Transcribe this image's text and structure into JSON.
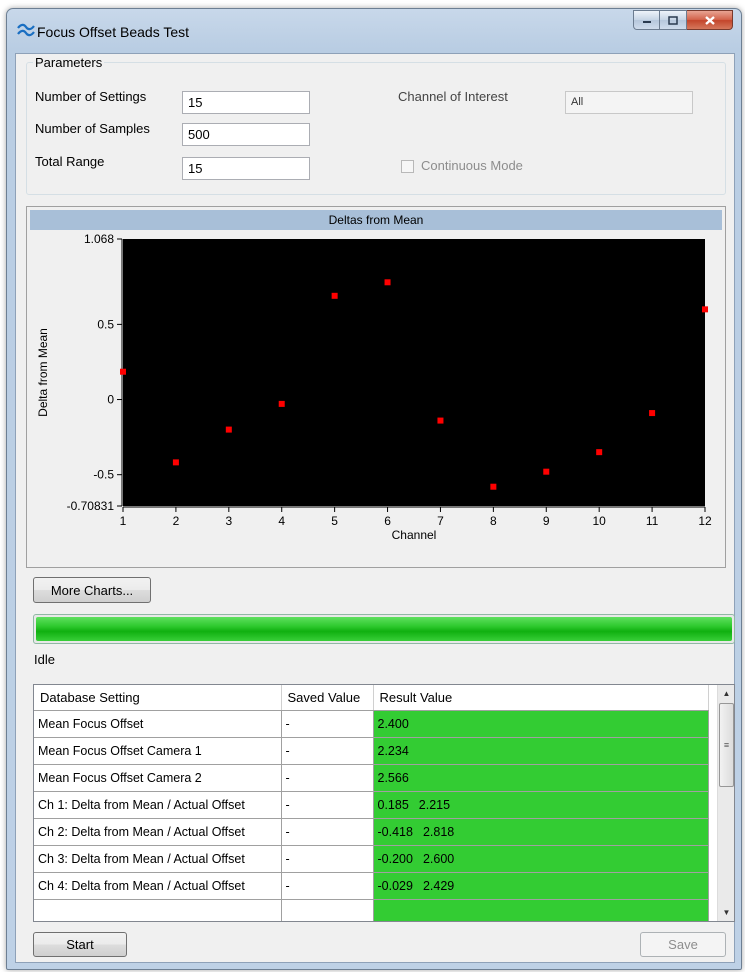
{
  "window": {
    "title": "Focus Offset Beads Test",
    "app_icon": "wave-icon",
    "controls": [
      "minimize-icon",
      "maximize-icon",
      "close-icon"
    ]
  },
  "parameters": {
    "group_label": "Parameters",
    "number_of_settings_label": "Number of Settings",
    "number_of_settings_value": "15",
    "number_of_samples_label": "Number of Samples",
    "number_of_samples_value": "500",
    "total_range_label": "Total Range",
    "total_range_value": "15",
    "channel_of_interest_label": "Channel of Interest",
    "channel_of_interest_value": "All",
    "continuous_mode_label": "Continuous Mode",
    "continuous_mode_checked": false
  },
  "chart_data": {
    "type": "scatter",
    "title": "Deltas from Mean",
    "xlabel": "Channel",
    "ylabel": "Delta from Mean",
    "xlim": [
      1,
      12
    ],
    "ylim": [
      -0.70831,
      1.068
    ],
    "xticks": [
      "1",
      "2",
      "3",
      "4",
      "5",
      "6",
      "7",
      "8",
      "9",
      "10",
      "11",
      "12"
    ],
    "yticks": [
      {
        "value": 1.068,
        "label": "1.068"
      },
      {
        "value": 0.5,
        "label": "0.5"
      },
      {
        "value": 0,
        "label": "0"
      },
      {
        "value": -0.5,
        "label": "-0.5"
      },
      {
        "value": -0.70831,
        "label": "-0.70831"
      }
    ],
    "background": "#000000",
    "marker_color": "#ff0000",
    "grid": false,
    "points": [
      {
        "x": 1,
        "y": 0.185
      },
      {
        "x": 2,
        "y": -0.418
      },
      {
        "x": 3,
        "y": -0.2
      },
      {
        "x": 4,
        "y": -0.029
      },
      {
        "x": 5,
        "y": 0.69
      },
      {
        "x": 6,
        "y": 0.78
      },
      {
        "x": 7,
        "y": -0.14
      },
      {
        "x": 8,
        "y": -0.58
      },
      {
        "x": 9,
        "y": -0.48
      },
      {
        "x": 10,
        "y": -0.35
      },
      {
        "x": 11,
        "y": -0.09
      },
      {
        "x": 12,
        "y": 0.6
      }
    ]
  },
  "more_charts_button": "More Charts...",
  "progress": {
    "value": 1.0,
    "color": "#22c322"
  },
  "status_text": "Idle",
  "grid": {
    "columns": [
      "Database Setting",
      "Saved Value",
      "Result Value"
    ],
    "rows": [
      {
        "setting": "Mean Focus Offset",
        "saved": "-",
        "result": "2.400",
        "result2": ""
      },
      {
        "setting": "Mean Focus Offset Camera 1",
        "saved": "-",
        "result": "2.234",
        "result2": ""
      },
      {
        "setting": "Mean Focus Offset Camera 2",
        "saved": "-",
        "result": "2.566",
        "result2": ""
      },
      {
        "setting": "Ch 1: Delta from Mean / Actual Offset",
        "saved": "-",
        "result": "0.185",
        "result2": "2.215"
      },
      {
        "setting": "Ch 2: Delta from Mean / Actual Offset",
        "saved": "-",
        "result": "-0.418",
        "result2": "2.818"
      },
      {
        "setting": "Ch 3: Delta from Mean / Actual Offset",
        "saved": "-",
        "result": "-0.200",
        "result2": "2.600"
      },
      {
        "setting": "Ch 4: Delta from Mean / Actual Offset",
        "saved": "-",
        "result": "-0.029",
        "result2": "2.429"
      },
      {
        "setting": "",
        "saved": "",
        "result": "",
        "result2": ""
      }
    ],
    "result_color": "#33cc33"
  },
  "buttons": {
    "start": "Start",
    "save": "Save"
  }
}
